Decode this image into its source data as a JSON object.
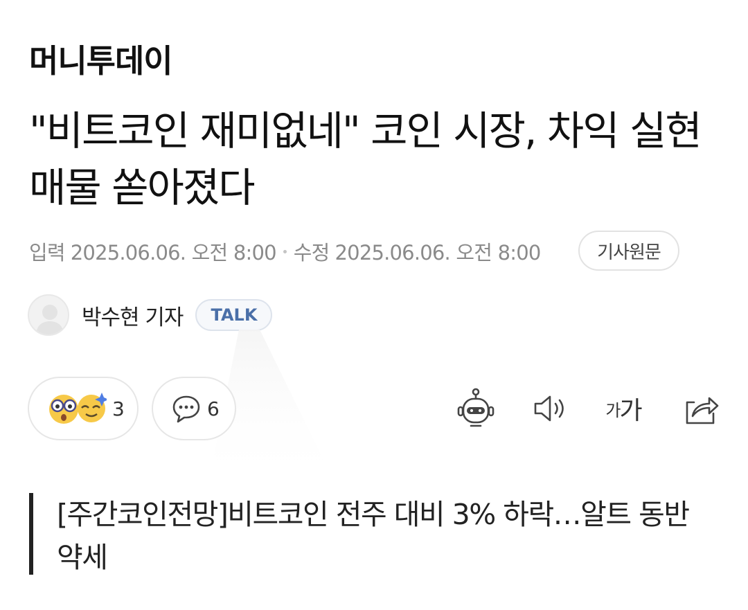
{
  "article": {
    "press": "머니투데이",
    "headline": "\"비트코인 재미없네\" 코인 시장, 차익 실현 매물 쏟아졌다",
    "meta": {
      "input_label": "입력",
      "input_datetime": "2025.06.06. 오전 8:00",
      "modified_label": "수정",
      "modified_datetime": "2025.06.06. 오전 8:00",
      "original_button": "기사원문"
    },
    "reporter": {
      "name": "박수현 기자",
      "talk_label": "TALK"
    },
    "reactions": {
      "reaction_count": "3",
      "comment_count": "6"
    },
    "toolbar": {
      "font_small": "가",
      "font_large": "가"
    },
    "subhead": "[주간코인전망]비트코인 전주 대비 3% 하락…알트 동반 약세"
  },
  "icons": {
    "avatar": "person-silhouette-icon",
    "reaction": "reaction-emoji-icon",
    "comment": "speech-bubble-icon",
    "summary": "robot-icon",
    "read_aloud": "speaker-icon",
    "font_size": "font-size-icon",
    "share": "share-icon"
  },
  "colors": {
    "talk_text": "#4a6fa8",
    "meta_text": "#8a8a8a",
    "emoji_yellow": "#f7c948"
  }
}
